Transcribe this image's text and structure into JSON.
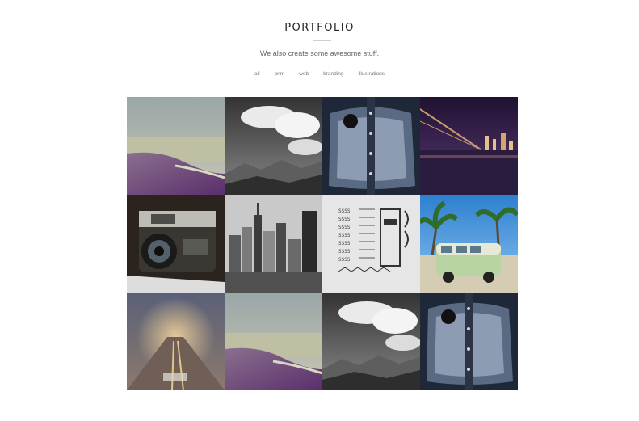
{
  "page": {
    "title": "PORTFOLIO",
    "subtitle": "We also create some awesome stuff."
  },
  "filters": [
    "all",
    "print",
    "web",
    "branding",
    "illustrations"
  ],
  "portfolio_items": [
    {
      "name": "beach-photo"
    },
    {
      "name": "mountain-clouds-photo"
    },
    {
      "name": "vintage-metal-photo"
    },
    {
      "name": "bridge-night-photo"
    },
    {
      "name": "camera-photo"
    },
    {
      "name": "city-skyline-photo"
    },
    {
      "name": "typography-print-photo"
    },
    {
      "name": "vw-bus-photo"
    },
    {
      "name": "foggy-road-photo"
    },
    {
      "name": "beach-photo"
    },
    {
      "name": "mountain-clouds-photo"
    },
    {
      "name": "vintage-metal-photo"
    }
  ]
}
